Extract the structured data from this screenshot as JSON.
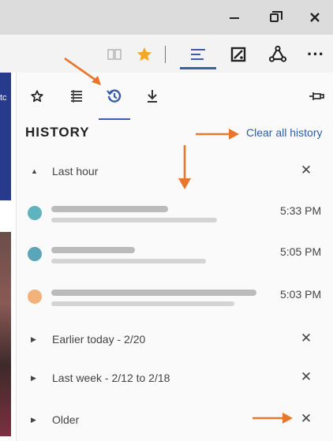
{
  "window": {
    "minimize_icon": "minimize-icon",
    "maximize_icon": "restore-icon",
    "close_icon": "close-icon"
  },
  "toolbar": {
    "icons": [
      "reading-view-icon",
      "favorite-star-icon",
      "hub-icon",
      "web-note-icon",
      "share-icon",
      "more-icon"
    ],
    "more_label": "···",
    "star_color": "#f5a623"
  },
  "hub": {
    "tabs": [
      "favorites-icon",
      "reading-list-icon",
      "history-icon",
      "downloads-icon"
    ],
    "active_tab": "history",
    "pin_icon": "pin-icon"
  },
  "history": {
    "heading": "HISTORY",
    "clear_all": "Clear all history",
    "groups": [
      {
        "label": "Last hour",
        "expanded": true,
        "close": "✕"
      },
      {
        "label": "Earlier today - 2/20",
        "expanded": false,
        "close": "✕"
      },
      {
        "label": "Last week - 2/12 to 2/18",
        "expanded": false,
        "close": "✕"
      },
      {
        "label": "Older",
        "expanded": false,
        "close": "✕"
      }
    ],
    "entries": [
      {
        "time": "5:33 PM",
        "favicon_color": "#5fb3bf"
      },
      {
        "time": "5:05 PM",
        "favicon_color": "#5aa6b8"
      },
      {
        "time": "5:03 PM",
        "favicon_color": "#f2b27a"
      }
    ]
  },
  "annotations": {
    "arrow_color": "#e8772e"
  },
  "left_page": {
    "text": "tc"
  },
  "colors": {
    "accent": "#3a5fa8",
    "link": "#2e5fa8"
  }
}
